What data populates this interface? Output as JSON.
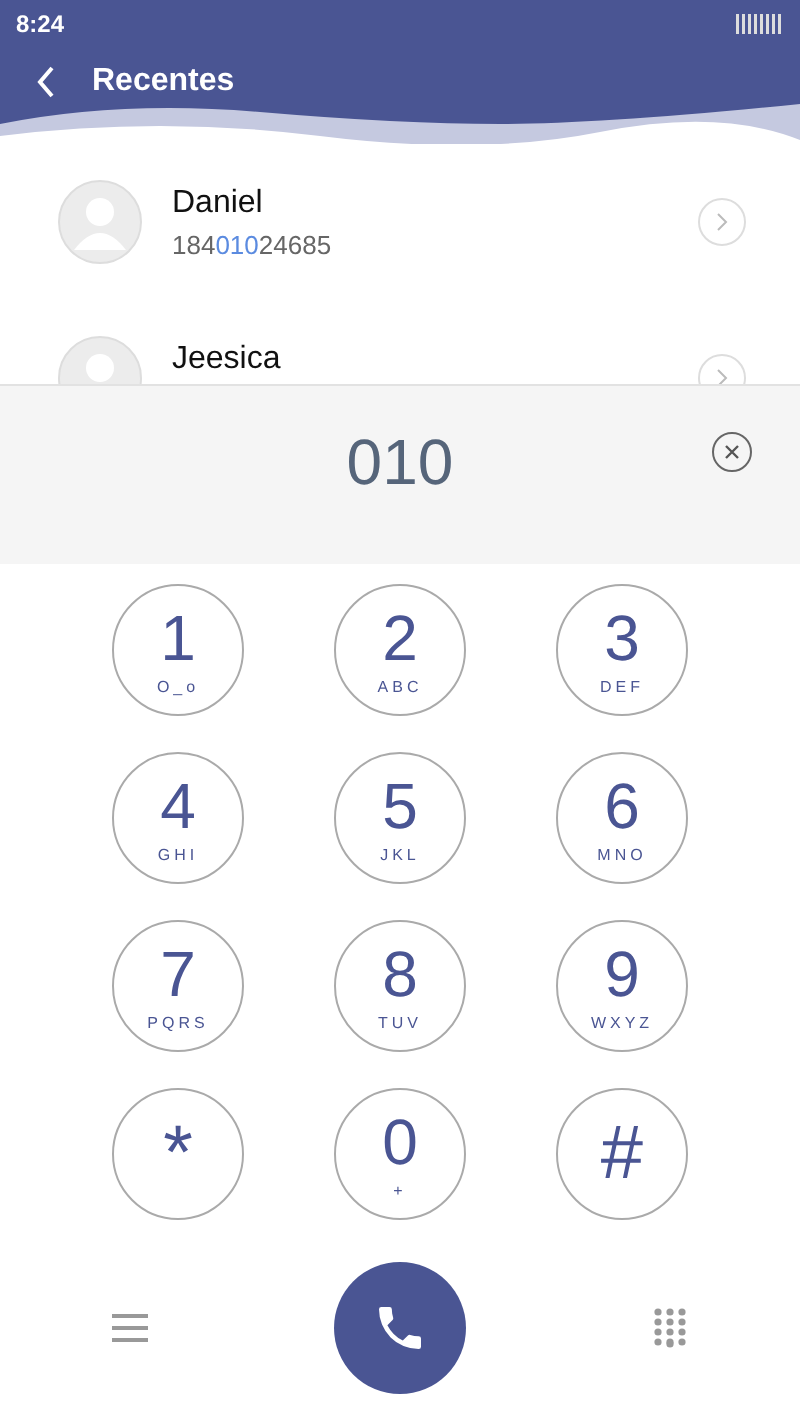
{
  "status_bar": {
    "time": "8:24"
  },
  "header": {
    "title": "Recentes"
  },
  "contacts": [
    {
      "name": "Daniel",
      "number": {
        "before": "184",
        "match": "010",
        "after": "24685"
      }
    },
    {
      "name": "Jeesica"
    }
  ],
  "dial_display": {
    "value": "010"
  },
  "keys": [
    {
      "digit": "1",
      "letters": "O_o"
    },
    {
      "digit": "2",
      "letters": "ABC"
    },
    {
      "digit": "3",
      "letters": "DEF"
    },
    {
      "digit": "4",
      "letters": "GHI"
    },
    {
      "digit": "5",
      "letters": "JKL"
    },
    {
      "digit": "6",
      "letters": "MNO"
    },
    {
      "digit": "7",
      "letters": "PQRS"
    },
    {
      "digit": "8",
      "letters": "TUV"
    },
    {
      "digit": "9",
      "letters": "WXYZ"
    },
    {
      "digit": "*"
    },
    {
      "digit": "0",
      "letters": "+"
    },
    {
      "digit": "#"
    }
  ]
}
